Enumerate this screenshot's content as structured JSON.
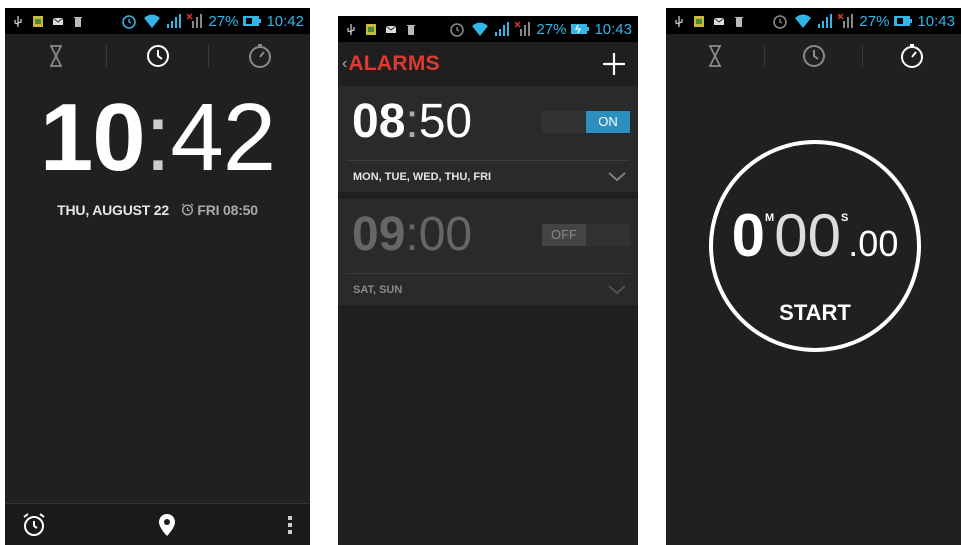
{
  "status_bar": [
    {
      "battery": "27%",
      "time": "10:42"
    },
    {
      "battery": "27%",
      "time": "10:43"
    },
    {
      "battery": "27%",
      "time": "10:43"
    }
  ],
  "clock_screen": {
    "tabs": [
      "hourglass-icon",
      "clock-icon",
      "stopwatch-icon"
    ],
    "hour": "10",
    "colon": ":",
    "minute": "42",
    "date": "THU, AUGUST 22",
    "next_alarm": "FRI 08:50",
    "bottom_icons": [
      "alarm-icon",
      "location-pin-icon",
      "overflow-menu-icon"
    ]
  },
  "alarms_screen": {
    "title": "ALARMS",
    "back": "‹",
    "add": "+",
    "alarms": [
      {
        "hour": "08",
        "colon": ":",
        "minute": "50",
        "toggle": "ON",
        "enabled": true,
        "days": "MON, TUE, WED, THU, FRI"
      },
      {
        "hour": "09",
        "colon": ":",
        "minute": "00",
        "toggle": "OFF",
        "enabled": false,
        "days": "SAT, SUN"
      }
    ]
  },
  "stopwatch_screen": {
    "minutes": "0",
    "minutes_unit": "M",
    "seconds": "00",
    "seconds_unit": "S",
    "hundredths": ".00",
    "start_label": "START"
  },
  "colors": {
    "accent": "#33b5e5",
    "title_red": "#e03a2f",
    "toggle_on": "#2d8fbf",
    "background": "#202020"
  }
}
